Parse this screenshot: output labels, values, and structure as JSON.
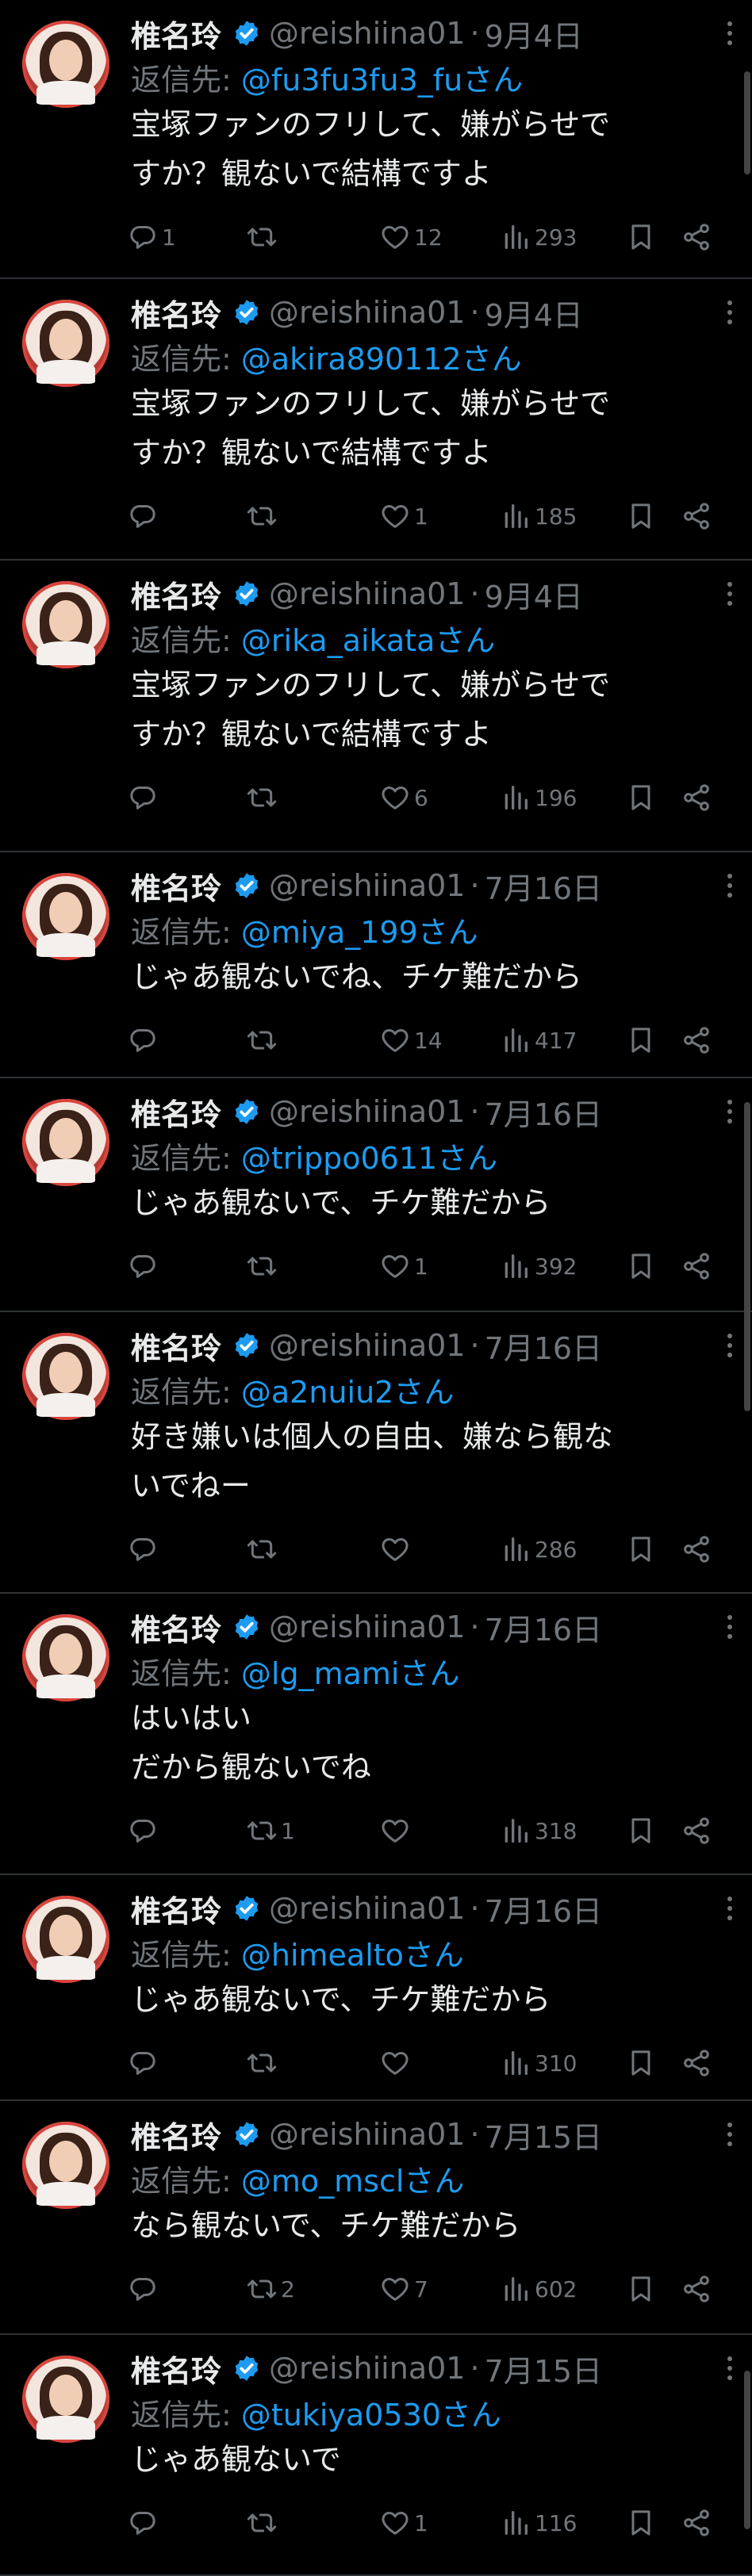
{
  "account": {
    "name": "椎名玲",
    "handle": "@reishiina01",
    "reply_prefix": "返信先: ",
    "reply_suffix": "さん"
  },
  "colors": {
    "background": "#000000",
    "text": "#e7e9ea",
    "muted": "#71767b",
    "link": "#1d9bf0",
    "verified": "#1d9bf0"
  },
  "tweets": [
    {
      "date": "9月4日",
      "reply_to": "@fu3fu3fu3_fu",
      "text": "宝塚ファンのフリして、嫌がらせで\nすか？観ないで結構ですよ",
      "replies": "1",
      "retweets": "",
      "likes": "12",
      "views": "293"
    },
    {
      "date": "9月4日",
      "reply_to": "@akira890112",
      "text": "宝塚ファンのフリして、嫌がらせで\nすか？観ないで結構ですよ",
      "replies": "",
      "retweets": "",
      "likes": "1",
      "views": "185"
    },
    {
      "date": "9月4日",
      "reply_to": "@rika_aikata",
      "text": "宝塚ファンのフリして、嫌がらせで\nすか？観ないで結構ですよ",
      "replies": "",
      "retweets": "",
      "likes": "6",
      "views": "196"
    },
    {
      "date": "7月16日",
      "reply_to": "@miya_199",
      "text": "じゃあ観ないでね、チケ難だから",
      "replies": "",
      "retweets": "",
      "likes": "14",
      "views": "417"
    },
    {
      "date": "7月16日",
      "reply_to": "@trippo0611",
      "text": "じゃあ観ないで、チケ難だから",
      "replies": "",
      "retweets": "",
      "likes": "1",
      "views": "392"
    },
    {
      "date": "7月16日",
      "reply_to": "@a2nuiu2",
      "text": "好き嫌いは個人の自由、嫌なら観な\nいでねー",
      "replies": "",
      "retweets": "",
      "likes": "",
      "views": "286"
    },
    {
      "date": "7月16日",
      "reply_to": "@lg_mami",
      "text": "はいはい\nだから観ないでね",
      "replies": "",
      "retweets": "1",
      "likes": "",
      "views": "318"
    },
    {
      "date": "7月16日",
      "reply_to": "@himealto",
      "text": "じゃあ観ないで、チケ難だから",
      "replies": "",
      "retweets": "",
      "likes": "",
      "views": "310"
    },
    {
      "date": "7月15日",
      "reply_to": "@mo_mscl",
      "text": "なら観ないで、チケ難だから",
      "replies": "",
      "retweets": "2",
      "likes": "7",
      "views": "602"
    },
    {
      "date": "7月15日",
      "reply_to": "@tukiya0530",
      "text": "じゃあ観ないで",
      "replies": "",
      "retweets": "",
      "likes": "1",
      "views": "116"
    }
  ]
}
